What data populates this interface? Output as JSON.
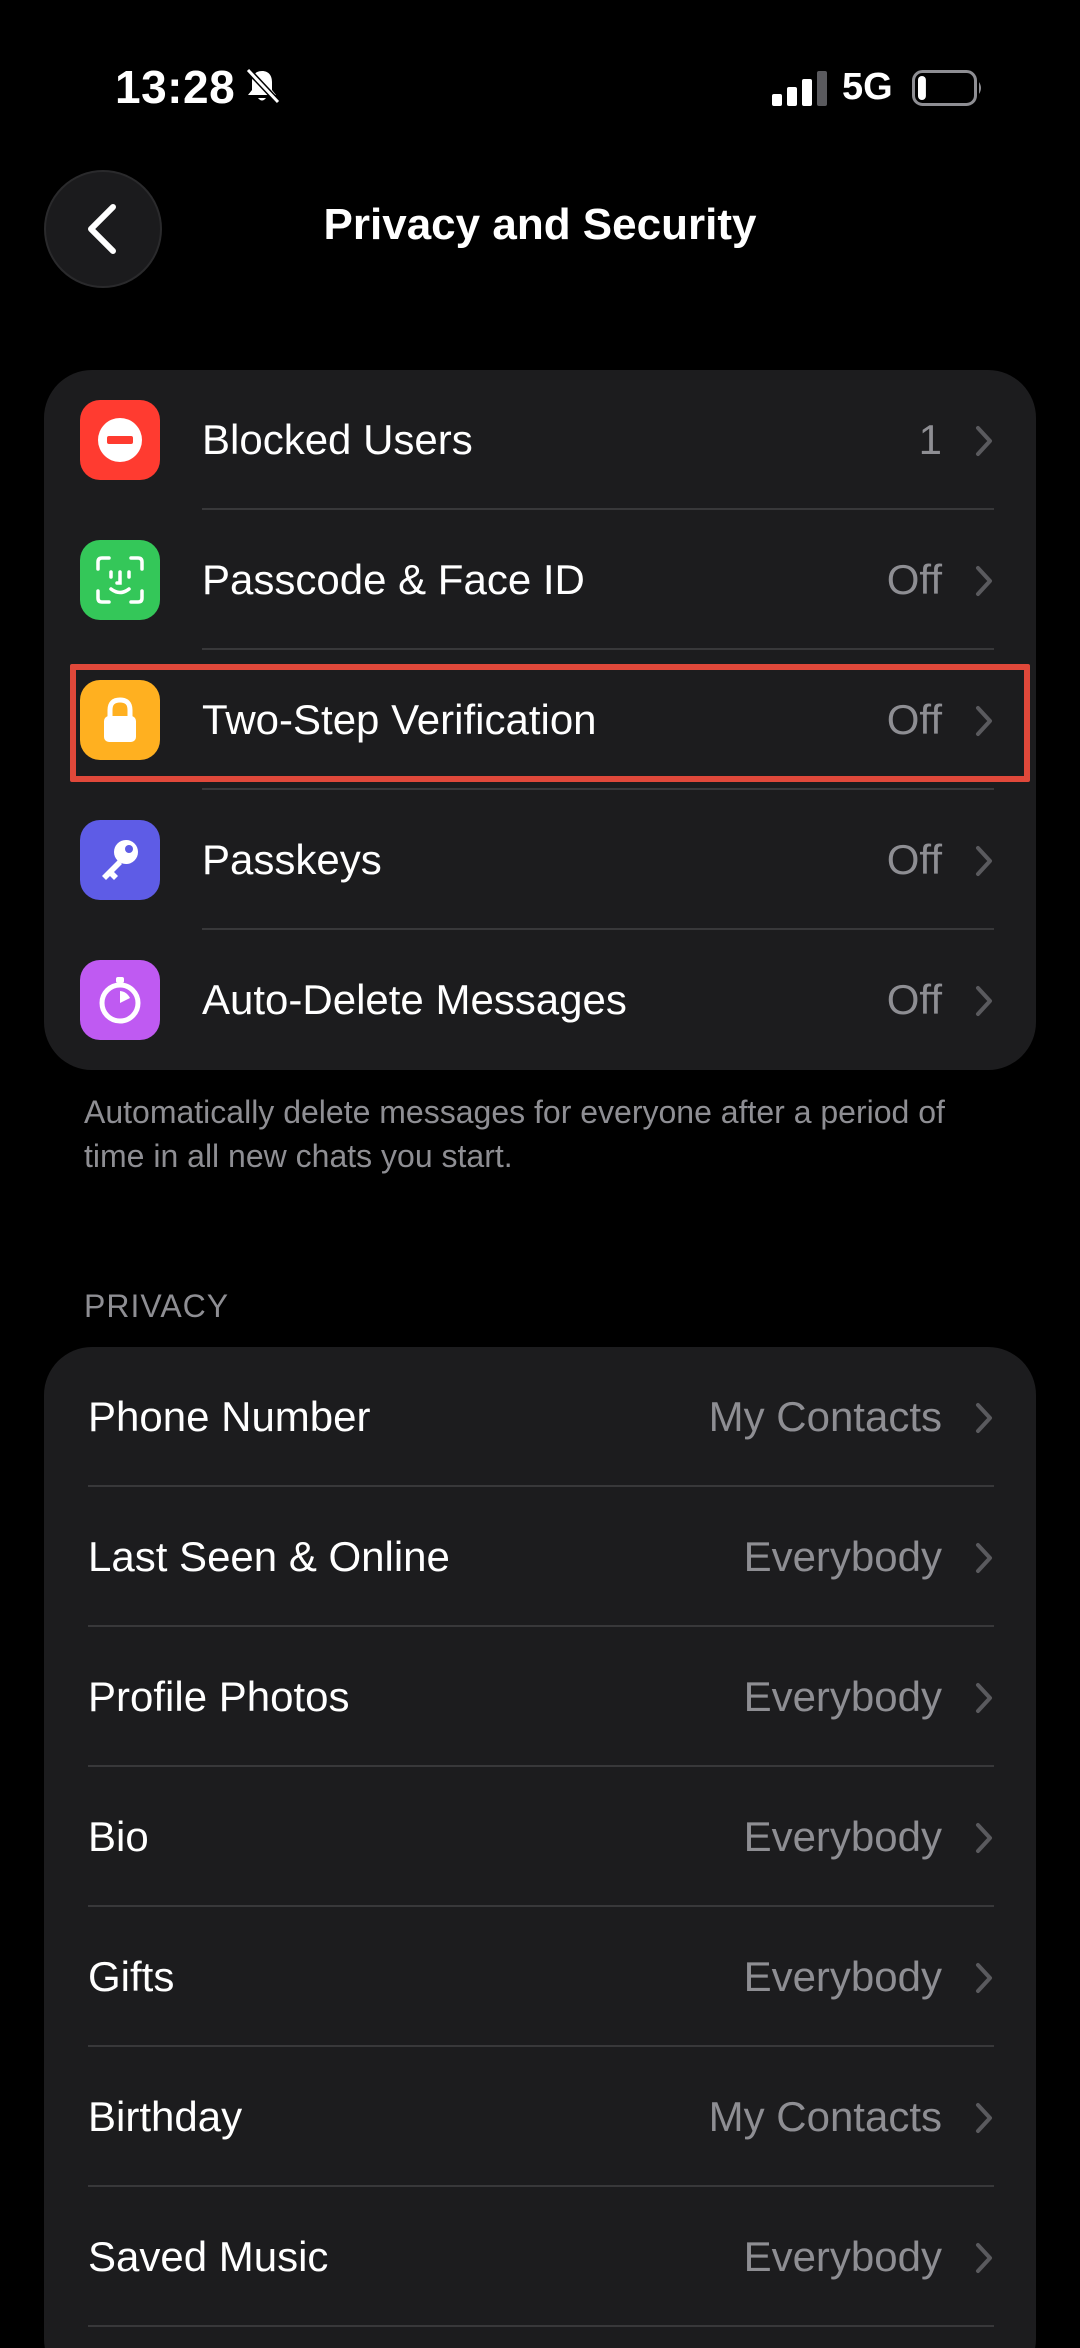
{
  "status_bar": {
    "time": "13:28",
    "network": "5G",
    "battery_level": 0.15,
    "bell_icon": "bell-slash-icon",
    "signal_icon": "cellular-signal-icon"
  },
  "nav": {
    "title": "Privacy and Security",
    "back_icon": "chevron-left-icon"
  },
  "security_group": {
    "items": [
      {
        "label": "Blocked Users",
        "value": "1",
        "icon": "blocked-icon",
        "color": "#ff3b30"
      },
      {
        "label": "Passcode & Face ID",
        "value": "Off",
        "icon": "face-id-icon",
        "color": "#34c759"
      },
      {
        "label": "Two-Step Verification",
        "value": "Off",
        "icon": "lock-icon",
        "color": "#ffb020"
      },
      {
        "label": "Passkeys",
        "value": "Off",
        "icon": "key-icon",
        "color": "#5e5ce6"
      },
      {
        "label": "Auto-Delete Messages",
        "value": "Off",
        "icon": "timer-icon",
        "color": "#bf5af2"
      }
    ],
    "footer": "Automatically delete messages for everyone after a period of time in all new chats you start."
  },
  "privacy_group": {
    "header": "PRIVACY",
    "items": [
      {
        "label": "Phone Number",
        "value": "My Contacts"
      },
      {
        "label": "Last Seen & Online",
        "value": "Everybody"
      },
      {
        "label": "Profile Photos",
        "value": "Everybody"
      },
      {
        "label": "Bio",
        "value": "Everybody"
      },
      {
        "label": "Gifts",
        "value": "Everybody"
      },
      {
        "label": "Birthday",
        "value": "My Contacts"
      },
      {
        "label": "Saved Music",
        "value": "Everybody"
      }
    ]
  },
  "colors": {
    "background": "#000000",
    "group_background": "#1c1c1e",
    "secondary_text": "#8e8e93",
    "highlight": "#e0483a"
  }
}
